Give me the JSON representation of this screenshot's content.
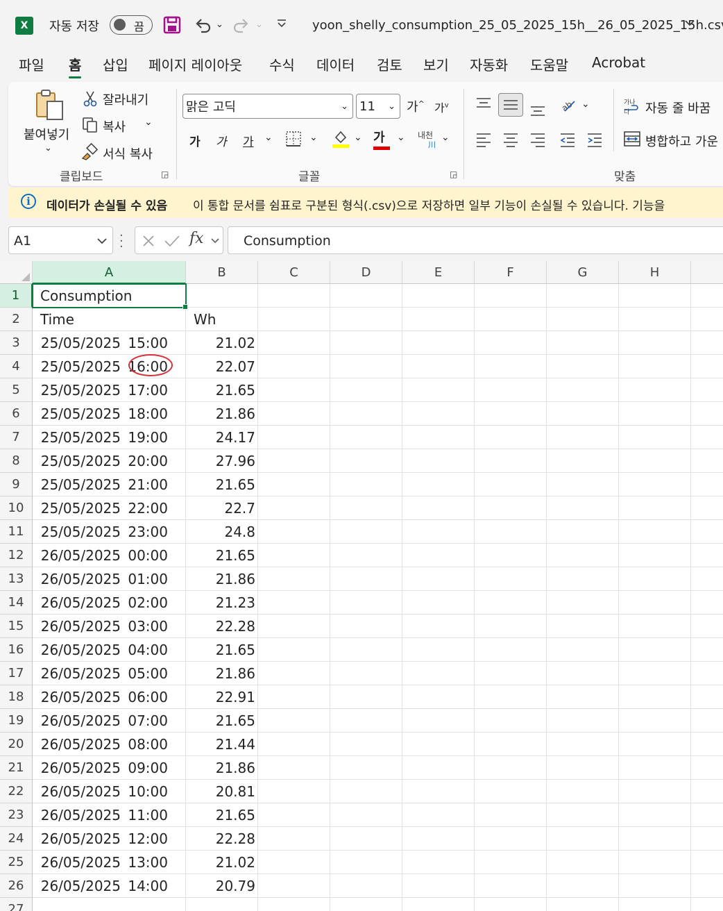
{
  "titlebar": {
    "app_icon": "X",
    "autosave_label": "자동 저장",
    "autosave_state": "끔",
    "filename": "yoon_shelly_consumption_25_05_2025_15h__26_05_2025_15h.csv",
    "icons": [
      "excel-logo-icon",
      "save-icon",
      "undo-icon",
      "redo-icon",
      "customize-qat-icon",
      "chevron-down-icon"
    ]
  },
  "tabs": [
    "파일",
    "홈",
    "삽입",
    "페이지 레이아웃",
    "수식",
    "데이터",
    "검토",
    "보기",
    "자동화",
    "도움말",
    "Acrobat"
  ],
  "active_tab": "홈",
  "ribbon": {
    "clipboard": {
      "paste": "붙여넣기",
      "cut": "잘라내기",
      "copy": "복사",
      "format_painter": "서식 복사",
      "label": "클립보드"
    },
    "font": {
      "font_name": "맑은 고딕",
      "font_size": "11",
      "grow": "가",
      "shrink": "가",
      "bold": "가",
      "italic": "가",
      "underline": "가",
      "font_color": "가",
      "phonetic": "내천",
      "label": "글꼴",
      "fill_color": "#ffff00",
      "text_color": "#e00000"
    },
    "alignment": {
      "wrap": "자동 줄 바꿈",
      "merge": "병합하고 가운",
      "label": "맞춤"
    }
  },
  "infobar": {
    "title": "데이터가 손실될 수 있음",
    "message": "이 통합 문서를 쉼표로 구분된 형식(.csv)으로 저장하면 일부 기능이 손실될 수 있습니다. 기능을"
  },
  "formula_bar": {
    "name_box": "A1",
    "fx": "fx",
    "content": "Consumption"
  },
  "sheet": {
    "columns": [
      "A",
      "B",
      "C",
      "D",
      "E",
      "F",
      "G",
      "H"
    ],
    "rows": [
      {
        "n": "1",
        "a": "Consumption",
        "b": ""
      },
      {
        "n": "2",
        "a": "Time",
        "b": "Wh"
      },
      {
        "n": "3",
        "a": "25/05/2025 15:00",
        "b": "21.02"
      },
      {
        "n": "4",
        "a": "25/05/2025 16:00",
        "b": "22.07"
      },
      {
        "n": "5",
        "a": "25/05/2025 17:00",
        "b": "21.65"
      },
      {
        "n": "6",
        "a": "25/05/2025 18:00",
        "b": "21.86"
      },
      {
        "n": "7",
        "a": "25/05/2025 19:00",
        "b": "24.17"
      },
      {
        "n": "8",
        "a": "25/05/2025 20:00",
        "b": "27.96"
      },
      {
        "n": "9",
        "a": "25/05/2025 21:00",
        "b": "21.65"
      },
      {
        "n": "10",
        "a": "25/05/2025 22:00",
        "b": "22.7"
      },
      {
        "n": "11",
        "a": "25/05/2025 23:00",
        "b": "24.8"
      },
      {
        "n": "12",
        "a": "26/05/2025 00:00",
        "b": "21.65"
      },
      {
        "n": "13",
        "a": "26/05/2025 01:00",
        "b": "21.86"
      },
      {
        "n": "14",
        "a": "26/05/2025 02:00",
        "b": "21.23"
      },
      {
        "n": "15",
        "a": "26/05/2025 03:00",
        "b": "22.28"
      },
      {
        "n": "16",
        "a": "26/05/2025 04:00",
        "b": "21.65"
      },
      {
        "n": "17",
        "a": "26/05/2025 05:00",
        "b": "21.86"
      },
      {
        "n": "18",
        "a": "26/05/2025 06:00",
        "b": "22.91"
      },
      {
        "n": "19",
        "a": "26/05/2025 07:00",
        "b": "21.65"
      },
      {
        "n": "20",
        "a": "26/05/2025 08:00",
        "b": "21.44"
      },
      {
        "n": "21",
        "a": "26/05/2025 09:00",
        "b": "21.86"
      },
      {
        "n": "22",
        "a": "26/05/2025 10:00",
        "b": "20.81"
      },
      {
        "n": "23",
        "a": "26/05/2025 11:00",
        "b": "21.65"
      },
      {
        "n": "24",
        "a": "26/05/2025 12:00",
        "b": "22.28"
      },
      {
        "n": "25",
        "a": "26/05/2025 13:00",
        "b": "21.02"
      },
      {
        "n": "26",
        "a": "26/05/2025 14:00",
        "b": "20.79"
      },
      {
        "n": "27",
        "a": "",
        "b": ""
      }
    ],
    "selected_cell": "A1",
    "annotation": "red circle around 16:00 in A4"
  }
}
